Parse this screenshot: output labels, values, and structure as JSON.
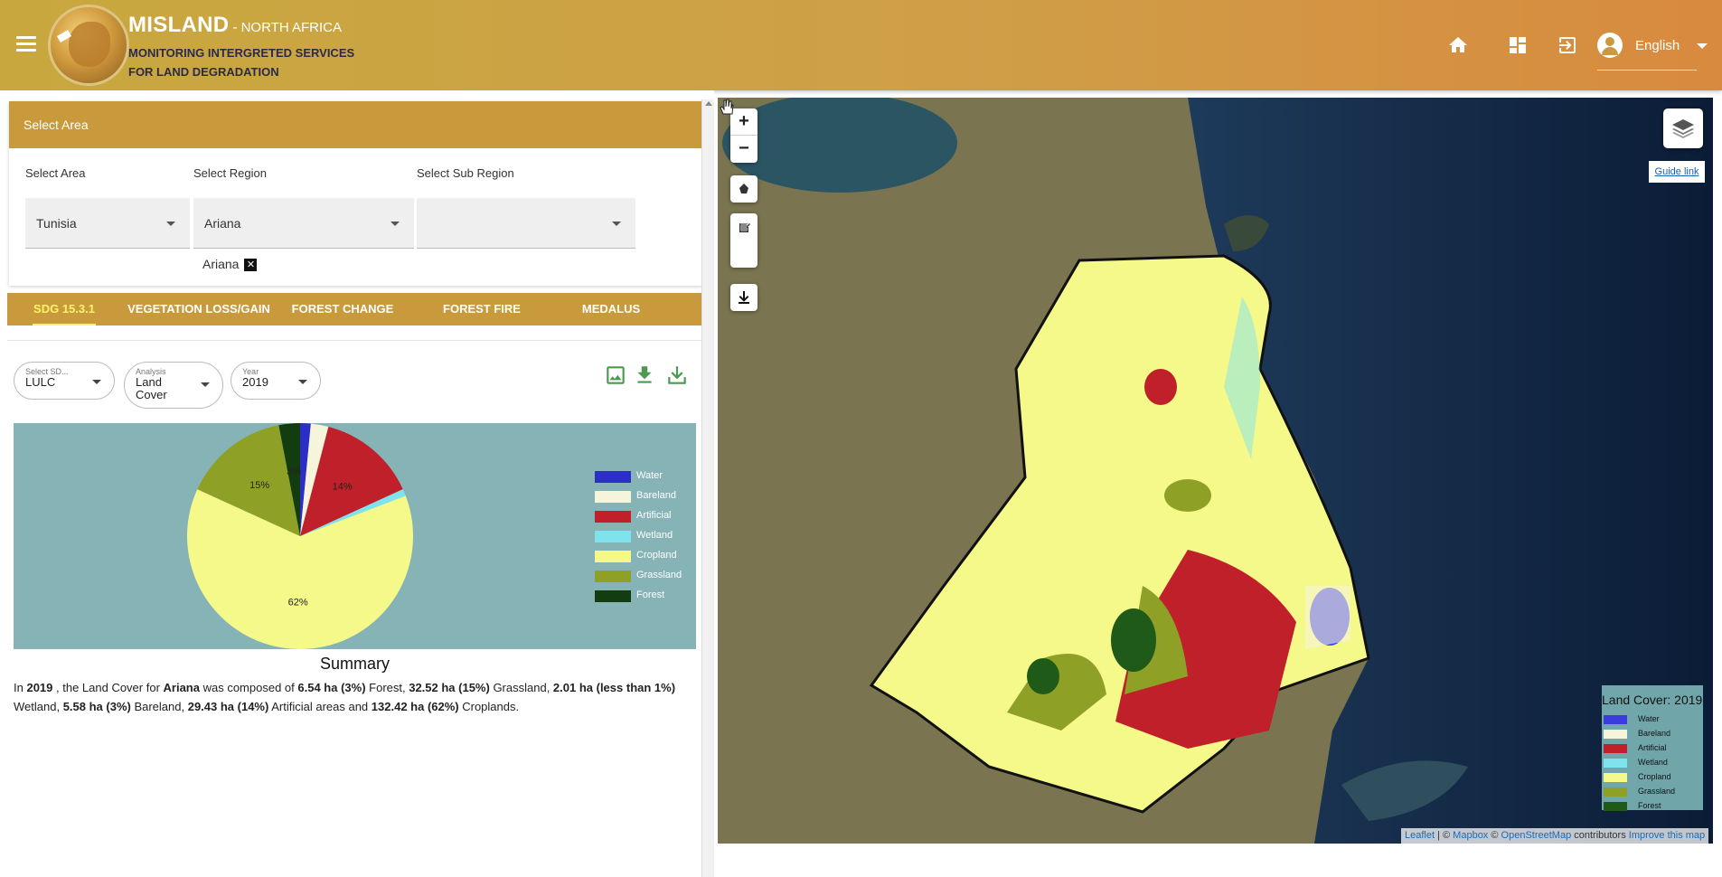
{
  "header": {
    "title": "MISLAND",
    "subtitle": "- NORTH AFRICA",
    "line1": "MONITORING INTERGRETED SERVICES",
    "line2": "FOR LAND DEGRADATION",
    "language": "English",
    "icons": [
      "home-icon",
      "dashboard-icon",
      "logout-icon",
      "account-icon"
    ]
  },
  "area": {
    "card_title": "Select Area",
    "area_label": "Select Area",
    "region_label": "Select Region",
    "subregion_label": "Select Sub Region",
    "area_value": "Tunisia",
    "region_value": "Ariana",
    "subregion_value": "",
    "chip": "Ariana"
  },
  "tabs": [
    {
      "label": "SDG 15.3.1",
      "active": true
    },
    {
      "label": "VEGETATION LOSS/GAIN",
      "active": false
    },
    {
      "label": "FOREST CHANGE",
      "active": false
    },
    {
      "label": "FOREST FIRE",
      "active": false
    },
    {
      "label": "MEDALUS",
      "active": false
    }
  ],
  "filters": {
    "sdg": {
      "label": "Select SD...",
      "value": "LULC"
    },
    "analysis": {
      "label": "Analysis",
      "value": "Land Cover"
    },
    "year": {
      "label": "Year",
      "value": "2019"
    }
  },
  "chart_data": {
    "type": "pie",
    "categories": [
      "Water",
      "Bareland",
      "Artificial",
      "Wetland",
      "Cropland",
      "Grassland",
      "Forest"
    ],
    "values": [
      1.5,
      2.5,
      14,
      1,
      62,
      15,
      3
    ],
    "labels": {
      "Artificial": "14%",
      "Cropland": "62%",
      "Grassland": "15%",
      "Forest": "3%"
    },
    "colors": [
      "#2b2fc7",
      "#f7f4dc",
      "#c0202a",
      "#7fe3ee",
      "#f5f98a",
      "#8fa027",
      "#133d10"
    ],
    "legend": "right"
  },
  "summary": {
    "title": "Summary",
    "p_in": "In ",
    "year": "2019",
    "p_a": " , the Land Cover for ",
    "region": "Ariana",
    "p_b": " was composed of ",
    "forest": "6.54 ha (3%)",
    "p_c": " Forest, ",
    "grassland": "32.52 ha (15%)",
    "p_d": " Grassland, ",
    "wetland": "2.01 ha (less than 1%)",
    "p_e": " Wetland, ",
    "bareland": "5.58 ha (3%)",
    "p_f": " Bareland, ",
    "artificial": "29.43 ha (14%)",
    "p_g": " Artificial areas and ",
    "cropland": "132.42 ha (62%)",
    "p_h": " Croplands."
  },
  "map": {
    "zoom_in": "+",
    "zoom_out": "−",
    "guide_link": "Guide link",
    "legend_title": "Land Cover: 2019",
    "legend": [
      {
        "name": "Water",
        "color": "#3a3ddb"
      },
      {
        "name": "Bareland",
        "color": "#f7f4dc"
      },
      {
        "name": "Artificial",
        "color": "#c0202a"
      },
      {
        "name": "Wetland",
        "color": "#7fe3ee"
      },
      {
        "name": "Cropland",
        "color": "#f5f98a"
      },
      {
        "name": "Grassland",
        "color": "#8fa027"
      },
      {
        "name": "Forest",
        "color": "#1f5a18"
      }
    ],
    "attr_leaflet": "Leaflet",
    "attr_sep1": " | © ",
    "attr_mapbox": "Mapbox",
    "attr_sep2": " © ",
    "attr_osm": "OpenStreetMap",
    "attr_contrib": " contributors ",
    "attr_improve": "Improve this map"
  }
}
